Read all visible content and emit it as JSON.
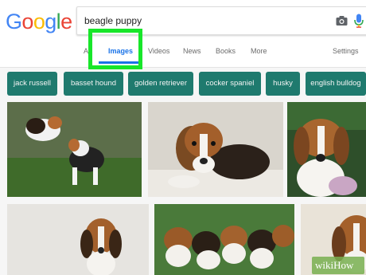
{
  "search": {
    "query": "beagle puppy"
  },
  "logo": {
    "letters": [
      "G",
      "o",
      "o",
      "g",
      "l",
      "e"
    ],
    "colors": [
      "#4285f4",
      "#ea4335",
      "#fbbc05",
      "#4285f4",
      "#34a853",
      "#ea4335"
    ]
  },
  "tabs": [
    {
      "label": "All",
      "visible": "Al"
    },
    {
      "label": "Images",
      "visible": "Images",
      "active": true
    },
    {
      "label": "Videos",
      "visible": "Videos"
    },
    {
      "label": "News",
      "visible": "News"
    },
    {
      "label": "Books",
      "visible": "Books"
    },
    {
      "label": "More",
      "visible": "More"
    },
    {
      "label": "Settings",
      "visible": "Settings"
    }
  ],
  "chips": [
    "jack russell",
    "basset hound",
    "golden retriever",
    "cocker spaniel",
    "husky",
    "english bulldog"
  ],
  "icons": {
    "camera": "camera-icon",
    "mic": "mic-icon"
  },
  "colors": {
    "accent": "#1a73e8",
    "chip": "#1f7a6e",
    "highlight": "#18e62a"
  },
  "watermark": {
    "text": "wikiHow"
  }
}
